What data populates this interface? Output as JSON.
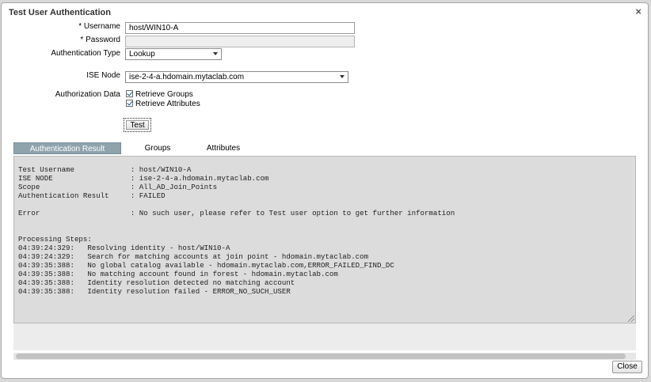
{
  "dialog": {
    "title": "Test User Authentication",
    "close_symbol": "×"
  },
  "form": {
    "username": {
      "label": "* Username",
      "value": "host/WIN10-A"
    },
    "password": {
      "label": "* Password",
      "value": ""
    },
    "auth_type": {
      "label": "Authentication Type",
      "value": "Lookup"
    },
    "ise_node": {
      "label": "ISE Node",
      "value": "ise-2-4-a.hdomain.mytaclab.com"
    },
    "authz_data": {
      "label": "Authorization Data",
      "retrieve_groups": {
        "label": "Retrieve Groups",
        "checked": true
      },
      "retrieve_attributes": {
        "label": "Retrieve Attributes",
        "checked": true
      }
    },
    "test_button": "Test"
  },
  "tabs": [
    {
      "label": "Authentication Result",
      "active": true
    },
    {
      "label": "Groups",
      "active": false
    },
    {
      "label": "Attributes",
      "active": false
    }
  ],
  "result": {
    "lines": [
      "Test Username             : host/WIN10-A",
      "ISE NODE                  : ise-2-4-a.hdomain.mytaclab.com",
      "Scope                     : All_AD_Join_Points",
      "Authentication Result     : FAILED",
      "",
      "Error                     : No such user, please refer to Test user option to get further information",
      "",
      "",
      "Processing Steps:",
      "04:39:24:329:   Resolving identity - host/WIN10-A",
      "04:39:24:329:   Search for matching accounts at join point - hdomain.mytaclab.com",
      "04:39:35:388:   No global catalog available - hdomain.mytaclab.com,ERROR_FAILED_FIND_DC",
      "04:39:35:388:   No matching account found in forest - hdomain.mytaclab.com",
      "04:39:35:388:   Identity resolution detected no matching account",
      "04:39:35:388:   Identity resolution failed - ERROR_NO_SUCH_USER"
    ]
  },
  "footer": {
    "close_button": "Close"
  },
  "colors": {
    "active_tab": "#8fa3ad",
    "result_background": "#dcdcdc"
  }
}
